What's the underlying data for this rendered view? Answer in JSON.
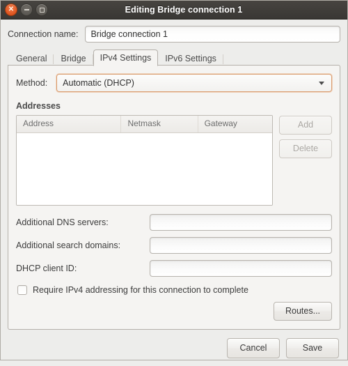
{
  "window": {
    "title": "Editing Bridge connection 1",
    "controls": {
      "close": "close-button",
      "minimize": "minimize-button",
      "maximize": "maximize-button"
    }
  },
  "connection": {
    "label": "Connection name:",
    "value": "Bridge connection 1"
  },
  "tabs": [
    {
      "label": "General",
      "active": false
    },
    {
      "label": "Bridge",
      "active": false
    },
    {
      "label": "IPv4 Settings",
      "active": true
    },
    {
      "label": "IPv6 Settings",
      "active": false
    }
  ],
  "ipv4": {
    "method": {
      "label": "Method:",
      "value": "Automatic (DHCP)"
    },
    "addresses": {
      "title": "Addresses",
      "columns": [
        "Address",
        "Netmask",
        "Gateway"
      ],
      "rows": [],
      "add_label": "Add",
      "delete_label": "Delete"
    },
    "dns": {
      "label": "Additional DNS servers:",
      "value": ""
    },
    "search_domains": {
      "label": "Additional search domains:",
      "value": ""
    },
    "dhcp_client_id": {
      "label": "DHCP client ID:",
      "value": ""
    },
    "require_ipv4": {
      "label": "Require IPv4 addressing for this connection to complete",
      "checked": false
    },
    "routes_label": "Routes..."
  },
  "actions": {
    "cancel_label": "Cancel",
    "save_label": "Save"
  },
  "colors": {
    "titlebar": "#3c3a36",
    "close_button": "#df5520",
    "focus_border": "#d99a6c",
    "panel_bg": "#f5f4f2",
    "window_bg": "#ededeb"
  }
}
